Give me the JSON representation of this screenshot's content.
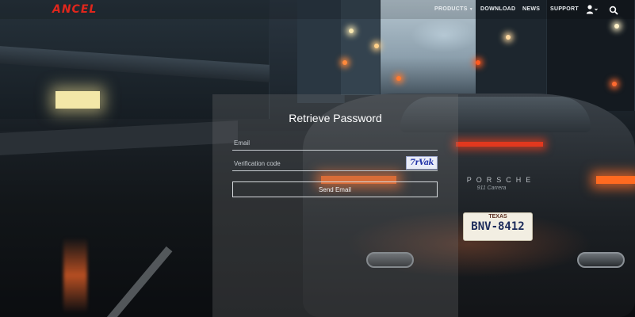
{
  "brand": {
    "logo_text": "ANCEL",
    "logo_accent": "#e0261c"
  },
  "nav": {
    "products": "PRODUCTS",
    "download": "DOWNLOAD",
    "news": "NEWS",
    "support": "SUPPORT",
    "user_icon": "user-icon",
    "search_icon": "search-icon"
  },
  "form": {
    "title": "Retrieve Password",
    "email_placeholder": "Email",
    "email_value": "",
    "code_placeholder": "Verification code",
    "code_value": "",
    "captcha_text": "7rVak",
    "submit_label": "Send Email"
  },
  "background": {
    "car_brand": "PORSCHE",
    "car_model": "911 Carrera",
    "plate_state": "TEXAS",
    "plate_number": "BNV-8412"
  }
}
